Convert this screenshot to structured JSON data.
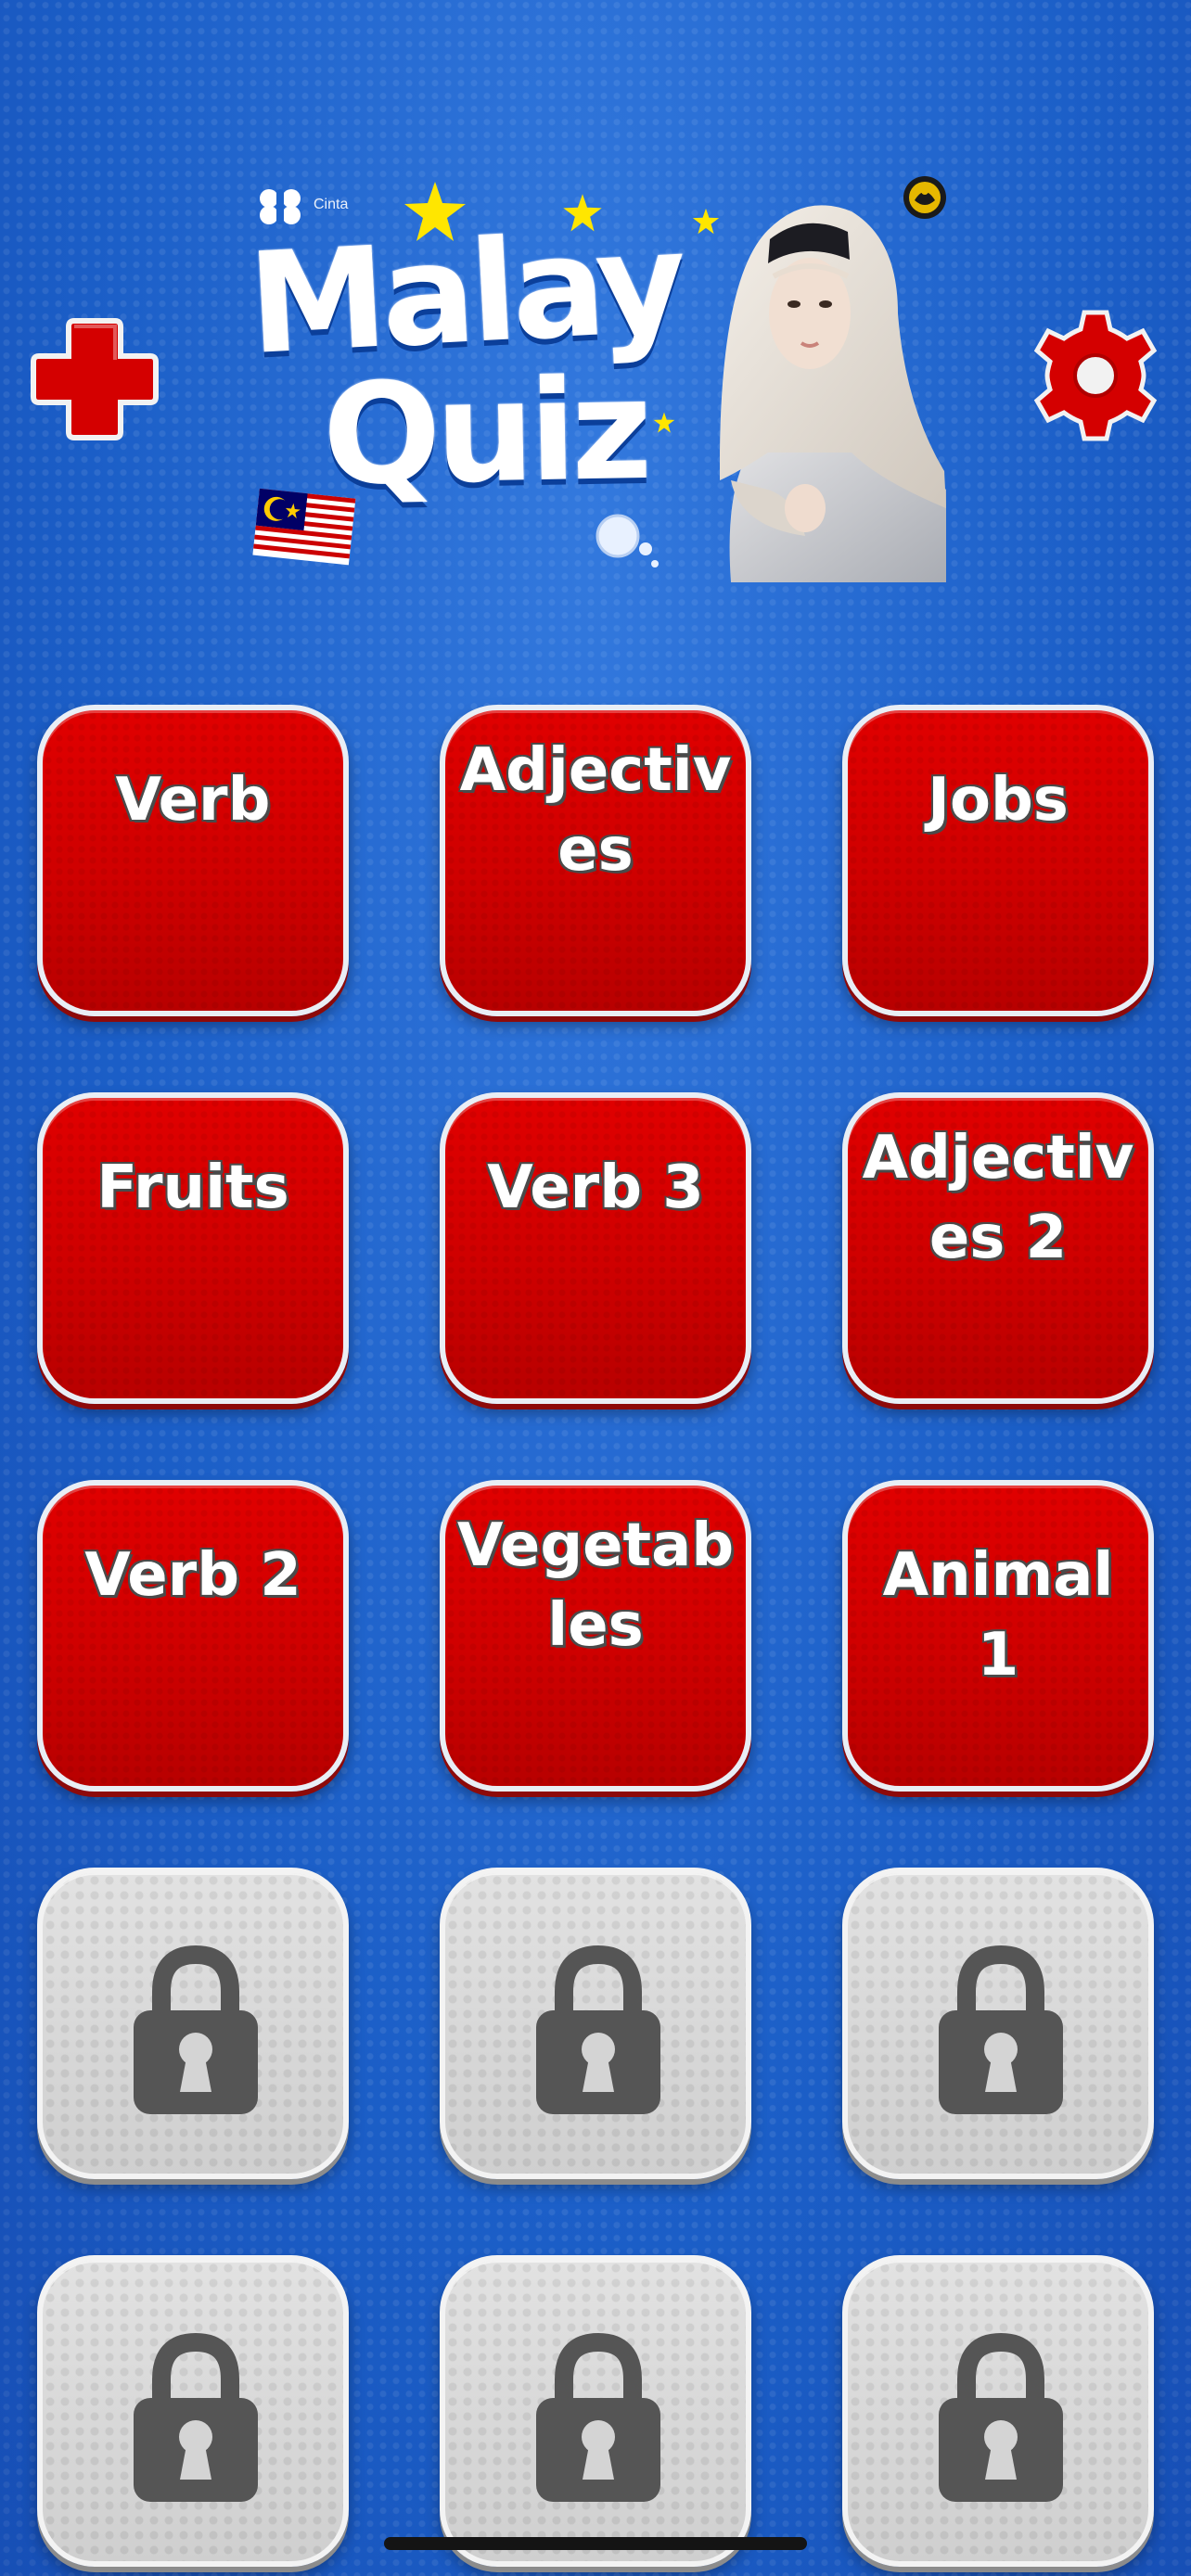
{
  "app": {
    "title_line1": "Malay",
    "title_line2": "Quiz",
    "brand_text": "Cinta"
  },
  "header": {
    "add_icon": "plus-icon",
    "settings_icon": "gear-icon",
    "accent_color": "#d40000"
  },
  "categories": [
    {
      "label": "Verb",
      "locked": false
    },
    {
      "label": "Adjectives",
      "locked": false
    },
    {
      "label": "Jobs",
      "locked": false
    },
    {
      "label": "Fruits",
      "locked": false
    },
    {
      "label": "Verb 3",
      "locked": false
    },
    {
      "label": "Adjectives 2",
      "locked": false
    },
    {
      "label": "Verb 2",
      "locked": false
    },
    {
      "label": "Vegetables",
      "locked": false
    },
    {
      "label": "Animal 1",
      "locked": false
    },
    {
      "label": "",
      "locked": true
    },
    {
      "label": "",
      "locked": true
    },
    {
      "label": "",
      "locked": true
    },
    {
      "label": "",
      "locked": true
    },
    {
      "label": "",
      "locked": true
    },
    {
      "label": "",
      "locked": true
    }
  ],
  "colors": {
    "background": "#1e64cc",
    "tile_unlocked": "#d20000",
    "tile_locked": "#d4d4d4",
    "lock": "#555555"
  }
}
